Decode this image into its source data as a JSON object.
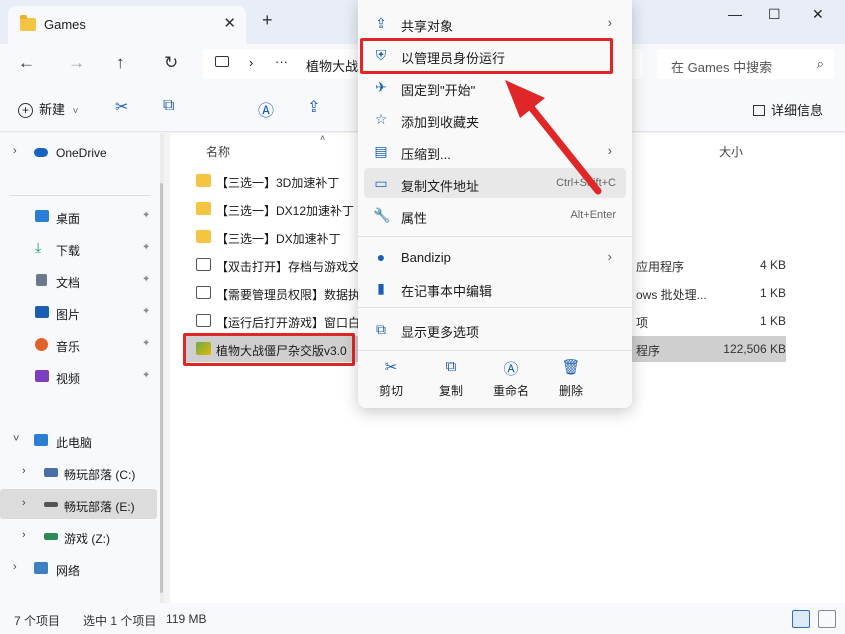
{
  "window": {
    "tab_title": "Games",
    "new_tab": "+",
    "close_tab": "✕",
    "minimize": "—",
    "maximize": "☐",
    "close": "✕"
  },
  "nav": {
    "back": "←",
    "forward": "→",
    "up": "↑",
    "refresh": "↻",
    "chevron": "›",
    "more": "···",
    "breadcrumb": "植物大战",
    "search_placeholder": "在 Games 中搜索",
    "search_icon": "⌕"
  },
  "toolbar": {
    "new_label": "新建",
    "new_dropdown": "˅",
    "details_label": "详细信息",
    "icons": [
      "cut-icon",
      "copy-icon",
      "rename-icon",
      "share-icon"
    ]
  },
  "sidebar": {
    "items": [
      {
        "label": "OneDrive",
        "expand": "›",
        "color": "#1565c0"
      },
      {
        "label": "桌面",
        "color": "#2a7fd4",
        "pinned": true
      },
      {
        "label": "下载",
        "color": "#1f9a5c",
        "pinned": true
      },
      {
        "label": "文档",
        "color": "#6b7a8f",
        "pinned": true
      },
      {
        "label": "图片",
        "color": "#1b5fb5",
        "pinned": true
      },
      {
        "label": "音乐",
        "color": "#e0612a",
        "pinned": true
      },
      {
        "label": "视频",
        "color": "#7d3fc2",
        "pinned": true
      },
      {
        "label": "此电脑",
        "expand": "˅",
        "color": "#2a7fd4"
      },
      {
        "label": "畅玩部落 (C:)",
        "expand": "›",
        "color": "#4a6fa5"
      },
      {
        "label": "畅玩部落 (E:)",
        "expand": "›",
        "color": "#555555",
        "selected": true
      },
      {
        "label": "游戏 (Z:)",
        "expand": "›",
        "color": "#2e8b57"
      },
      {
        "label": "网络",
        "expand": "›",
        "color": "#3f7fbf"
      }
    ],
    "pin_glyph": "📌"
  },
  "list": {
    "columns": {
      "name": "名称",
      "size": "大小"
    },
    "sort_arrow": "˄",
    "rows": [
      {
        "name": "【三选一】3D加速补丁",
        "kind": "folder",
        "type": "",
        "size": ""
      },
      {
        "name": "【三选一】DX12加速补丁",
        "kind": "folder",
        "type": "",
        "size": ""
      },
      {
        "name": "【三选一】DX加速补丁",
        "kind": "folder",
        "type": "",
        "size": ""
      },
      {
        "name": "【双击打开】存档与游戏文",
        "kind": "file",
        "type": "应用程序",
        "size": "4 KB"
      },
      {
        "name": "【需要管理员权限】数据执",
        "kind": "file",
        "type": "ows 批处理...",
        "size": "1 KB"
      },
      {
        "name": "【运行后打开游戏】窗口白",
        "kind": "file",
        "type": "项",
        "size": "1 KB"
      },
      {
        "name": "植物大战僵尸杂交版v3.0",
        "kind": "exe",
        "type": "程序",
        "size": "122,506 KB",
        "selected": true
      }
    ]
  },
  "context_menu": {
    "items": [
      {
        "label": "共享对象",
        "icon": "share-icon",
        "glyph": "⇪",
        "arrow": "›"
      },
      {
        "label": "以管理员身份运行",
        "icon": "shield-icon",
        "glyph": "⛨"
      },
      {
        "label": "固定到\"开始\"",
        "icon": "pin-icon",
        "glyph": "✈"
      },
      {
        "label": "添加到收藏夹",
        "icon": "star-icon",
        "glyph": "☆"
      },
      {
        "label": "压缩到...",
        "icon": "archive-icon",
        "glyph": "▤",
        "arrow": "›"
      },
      {
        "label": "复制文件地址",
        "icon": "path-icon",
        "glyph": "▭",
        "shortcut": "Ctrl+Shift+C"
      },
      {
        "label": "属性",
        "icon": "wrench-icon",
        "glyph": "🔧",
        "shortcut": "Alt+Enter"
      },
      {
        "label": "Bandizip",
        "icon": "bandizip-icon",
        "glyph": "●",
        "arrow": "›"
      },
      {
        "label": "在记事本中编辑",
        "icon": "notepad-icon",
        "glyph": "▮"
      },
      {
        "label": "显示更多选项",
        "icon": "more-options-icon",
        "glyph": "⧉"
      }
    ],
    "bottom": [
      {
        "label": "剪切",
        "icon": "cut-icon",
        "glyph": "✂"
      },
      {
        "label": "复制",
        "icon": "copy-icon",
        "glyph": "⧉"
      },
      {
        "label": "重命名",
        "icon": "rename-icon",
        "glyph": "Ⓐ"
      },
      {
        "label": "删除",
        "icon": "delete-icon",
        "glyph": "🗑"
      }
    ]
  },
  "status": {
    "count": "7 个项目",
    "selected": "选中 1 个项目",
    "size": "119 MB"
  },
  "colors": {
    "highlight_red": "#e02626",
    "accent_blue": "#1b5fb5"
  }
}
